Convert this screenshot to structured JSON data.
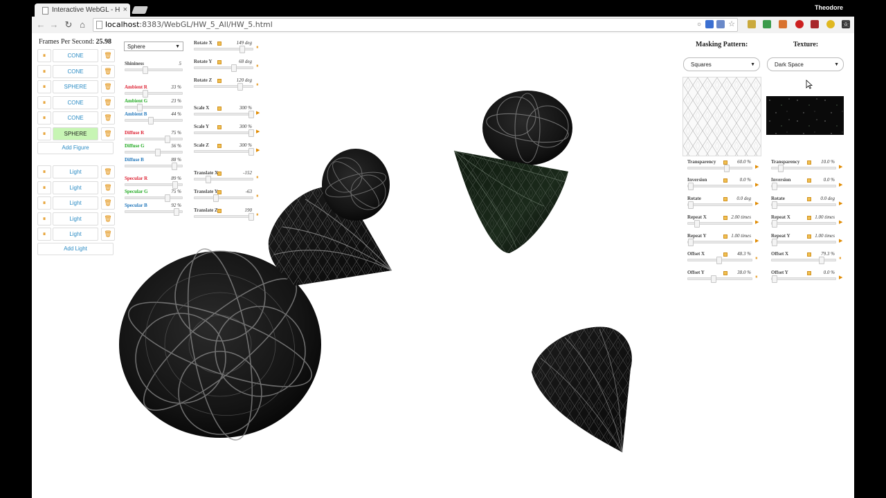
{
  "browser": {
    "tab_title": "Interactive WebGL - Home",
    "tab_close": "×",
    "user_name": "Theodore",
    "url_host": "localhost",
    "url_rest": ":8383/WebGL/HW_5_All/HW_5.html",
    "menu_icon": "☰"
  },
  "fps": {
    "label": "Frames Per Second:",
    "value": "25.98"
  },
  "figures": {
    "items": [
      {
        "label": "CONE",
        "active": false
      },
      {
        "label": "CONE",
        "active": false
      },
      {
        "label": "SPHERE",
        "active": false
      },
      {
        "label": "CONE",
        "active": false
      },
      {
        "label": "CONE",
        "active": false
      },
      {
        "label": "SPHERE",
        "active": true
      }
    ],
    "add_label": "Add Figure"
  },
  "lights": {
    "items": [
      {
        "label": "Light"
      },
      {
        "label": "Light"
      },
      {
        "label": "Light"
      },
      {
        "label": "Light"
      },
      {
        "label": "Light"
      }
    ],
    "add_label": "Add Light"
  },
  "material": {
    "shape_select": "Sphere",
    "sliders": [
      {
        "label": "Shininess",
        "value": "5",
        "frac": 0.33,
        "color": ""
      },
      {
        "label": "Ambient R",
        "value": "33 %",
        "frac": 0.33,
        "color": "red"
      },
      {
        "label": "Ambient G",
        "value": "23 %",
        "frac": 0.23,
        "color": "green"
      },
      {
        "label": "Ambient B",
        "value": "44 %",
        "frac": 0.44,
        "color": "blue"
      },
      {
        "label": "Diffuse R",
        "value": "75 %",
        "frac": 0.75,
        "color": "red"
      },
      {
        "label": "Diffuse G",
        "value": "56 %",
        "frac": 0.56,
        "color": "green"
      },
      {
        "label": "Diffuse B",
        "value": "88 %",
        "frac": 0.88,
        "color": "blue"
      },
      {
        "label": "Specular R",
        "value": "89 %",
        "frac": 0.89,
        "color": "red"
      },
      {
        "label": "Specular G",
        "value": "75 %",
        "frac": 0.75,
        "color": "green"
      },
      {
        "label": "Specular B",
        "value": "92 %",
        "frac": 0.92,
        "color": "blue"
      }
    ]
  },
  "transform": {
    "sliders": [
      {
        "label": "Rotate X",
        "value": "149 deg",
        "frac": 0.83
      },
      {
        "label": "Rotate Y",
        "value": "68 deg",
        "frac": 0.68
      },
      {
        "label": "Rotate Z",
        "value": "120 deg",
        "frac": 0.8
      },
      {
        "label": "Scale X",
        "value": "300 %",
        "frac": 1.0
      },
      {
        "label": "Scale Y",
        "value": "300 %",
        "frac": 1.0
      },
      {
        "label": "Scale Z",
        "value": "300 %",
        "frac": 1.0
      },
      {
        "label": "Translate X",
        "value": "-152",
        "frac": 0.2
      },
      {
        "label": "Translate Y",
        "value": "-63",
        "frac": 0.35
      },
      {
        "label": "Translate Z",
        "value": "190",
        "frac": 1.0
      }
    ]
  },
  "masking": {
    "heading": "Masking Pattern:",
    "select": "Squares",
    "sliders": [
      {
        "label": "Transparency",
        "value": "60.0 %",
        "frac": 0.6
      },
      {
        "label": "Inversion",
        "value": "0.0 %",
        "frac": 0.0
      },
      {
        "label": "Rotate",
        "value": "0.0 deg",
        "frac": 0.0
      },
      {
        "label": "Repeat X",
        "value": "2.00 times",
        "frac": 0.1
      },
      {
        "label": "Repeat Y",
        "value": "1.00 times",
        "frac": 0.0
      },
      {
        "label": "Offset X",
        "value": "48.3 %",
        "frac": 0.48
      },
      {
        "label": "Offset Y",
        "value": "38.0 %",
        "frac": 0.38
      }
    ]
  },
  "texture": {
    "heading": "Texture:",
    "select": "Dark Space",
    "sliders": [
      {
        "label": "Transparency",
        "value": "10.0 %",
        "frac": 0.1
      },
      {
        "label": "Inversion",
        "value": "0.0 %",
        "frac": 0.0
      },
      {
        "label": "Rotate",
        "value": "0.0 deg",
        "frac": 0.0
      },
      {
        "label": "Repeat X",
        "value": "1.00 times",
        "frac": 0.0
      },
      {
        "label": "Repeat Y",
        "value": "1.00 times",
        "frac": 0.0
      },
      {
        "label": "Offset X",
        "value": "79.3 %",
        "frac": 0.79
      },
      {
        "label": "Offset Y",
        "value": "0.0 %",
        "frac": 0.0
      }
    ]
  },
  "colors": {
    "accent": "#2a8bc4",
    "active_fill": "#c7f5b4",
    "pause": "#e08a00"
  }
}
